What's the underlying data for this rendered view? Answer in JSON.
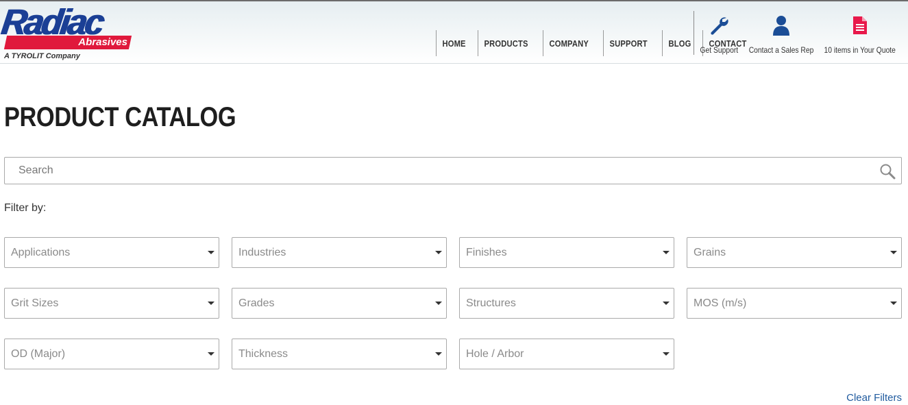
{
  "brand": {
    "name": "Radiac",
    "subtitle": "Abrasives",
    "tagline": "A TYROLIT Company",
    "primary_color": "#1b3f95",
    "accent_color": "#e0193c"
  },
  "nav": {
    "items": [
      "HOME",
      "PRODUCTS",
      "COMPANY",
      "SUPPORT",
      "BLOG",
      "CONTACT"
    ]
  },
  "utility": {
    "support": {
      "label": "Get Support",
      "icon": "wrench-icon"
    },
    "sales_rep": {
      "label": "Contact a Sales Rep",
      "icon": "person-icon"
    },
    "quote": {
      "label": "10 items in Your Quote",
      "icon": "document-icon"
    }
  },
  "page": {
    "title": "PRODUCT CATALOG"
  },
  "search": {
    "placeholder": "Search"
  },
  "filters": {
    "label": "Filter by:",
    "items": [
      "Applications",
      "Industries",
      "Finishes",
      "Grains",
      "Grit Sizes",
      "Grades",
      "Structures",
      "MOS (m/s)",
      "OD (Major)",
      "Thickness",
      "Hole / Arbor"
    ],
    "clear_label": "Clear Filters"
  }
}
